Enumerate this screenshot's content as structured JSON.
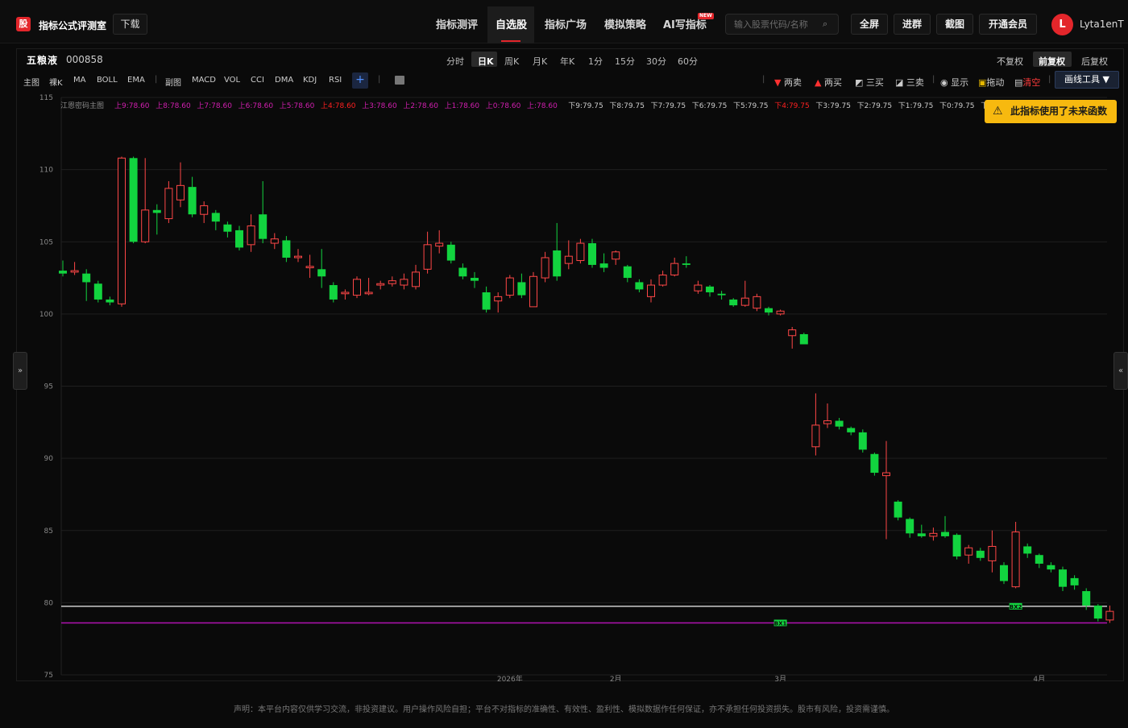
{
  "topbar": {
    "logo_char": "股",
    "brand": "指标公式评测室",
    "download": "下载",
    "nav": [
      "指标测评",
      "自选股",
      "指标广场",
      "模拟策略",
      "AI写指标"
    ],
    "new_badge": "NEW",
    "search_placeholder": "输入股票代码/名称",
    "buttons": [
      "全屏",
      "进群",
      "截图",
      "开通会员"
    ],
    "avatar_letter": "L",
    "username": "Lyta1enT"
  },
  "stock": {
    "name": "五粮液",
    "code": "000858"
  },
  "periods": [
    "分时",
    "日K",
    "周K",
    "月K",
    "年K",
    "1分",
    "15分",
    "30分",
    "60分"
  ],
  "active_period": "日K",
  "rights": [
    "不复权",
    "前复权",
    "后复权"
  ],
  "active_rights": "前复权",
  "indicators": {
    "main_label": "主图",
    "main": [
      "裸K",
      "MA",
      "BOLL",
      "EMA"
    ],
    "sub_label": "副图",
    "sub": [
      "MACD",
      "VOL",
      "CCI",
      "DMA",
      "KDJ",
      "RSI"
    ],
    "plus": "+"
  },
  "tools": [
    "两卖",
    "两买",
    "三买",
    "三卖",
    "显示",
    "拖动",
    "清空"
  ],
  "draw_tools": "画线工具 ▼",
  "warning": "此指标使用了未来函数",
  "legend": {
    "title": "江恩密码主图",
    "items": [
      {
        "text": "上9:78.60",
        "color": "#d21fb0"
      },
      {
        "text": "上8:78.60",
        "color": "#d21fb0"
      },
      {
        "text": "上7:78.60",
        "color": "#d21fb0"
      },
      {
        "text": "上6:78.60",
        "color": "#d21fb0"
      },
      {
        "text": "上5:78.60",
        "color": "#d21fb0"
      },
      {
        "text": "上4:78.60",
        "color": "#ff2020"
      },
      {
        "text": "上3:78.60",
        "color": "#d21fb0"
      },
      {
        "text": "上2:78.60",
        "color": "#d21fb0"
      },
      {
        "text": "上1:78.60",
        "color": "#d21fb0"
      },
      {
        "text": "上0:78.60",
        "color": "#d21fb0"
      },
      {
        "text": "上:78.60",
        "color": "#d21fb0"
      },
      {
        "text": "下9:79.75",
        "color": "#cccccc"
      },
      {
        "text": "下8:79.75",
        "color": "#cccccc"
      },
      {
        "text": "下7:79.75",
        "color": "#cccccc"
      },
      {
        "text": "下6:79.75",
        "color": "#cccccc"
      },
      {
        "text": "下5:79.75",
        "color": "#cccccc"
      },
      {
        "text": "下4:79.75",
        "color": "#ff2020"
      },
      {
        "text": "下3:79.75",
        "color": "#cccccc"
      },
      {
        "text": "下2:79.75",
        "color": "#cccccc"
      },
      {
        "text": "下1:79.75",
        "color": "#cccccc"
      },
      {
        "text": "下0:79.75",
        "color": "#cccccc"
      },
      {
        "text": "下",
        "color": "#cccccc"
      }
    ]
  },
  "chart_data": {
    "type": "candlestick",
    "y_ticks": [
      115,
      110,
      105,
      100,
      95,
      90,
      85,
      80,
      75
    ],
    "ylim": [
      75,
      115
    ],
    "x_labels": [
      "2026年",
      "2月",
      "3月",
      "4月"
    ],
    "x_label_index": [
      38,
      47,
      61,
      83
    ],
    "lines": [
      {
        "name": "上",
        "value": 78.6,
        "color": "#b012b0",
        "tag": "BX1",
        "tag_index": 61
      },
      {
        "name": "下",
        "value": 79.75,
        "color": "#cccccc",
        "tag": "BX2",
        "tag_index": 81
      }
    ],
    "up_color": "#ff4747",
    "down_color": "#12d43f",
    "candles": [
      [
        103.0,
        102.8,
        103.7,
        102.6
      ],
      [
        102.9,
        103.0,
        103.6,
        102.7
      ],
      [
        102.8,
        102.2,
        103.1,
        100.9
      ],
      [
        102.1,
        101.0,
        102.3,
        100.8
      ],
      [
        101.0,
        100.8,
        101.2,
        100.6
      ],
      [
        100.7,
        110.8,
        110.9,
        100.5
      ],
      [
        110.8,
        105.0,
        110.9,
        104.9
      ],
      [
        105.0,
        107.2,
        110.8,
        104.9
      ],
      [
        107.2,
        107.0,
        107.6,
        105.5
      ],
      [
        106.6,
        108.7,
        109.2,
        106.3
      ],
      [
        107.9,
        108.9,
        110.5,
        107.4
      ],
      [
        108.8,
        106.9,
        109.5,
        106.7
      ],
      [
        106.9,
        107.5,
        107.8,
        106.3
      ],
      [
        107.0,
        106.4,
        107.2,
        105.8
      ],
      [
        106.2,
        105.7,
        106.4,
        105.3
      ],
      [
        105.8,
        104.6,
        106.1,
        104.4
      ],
      [
        104.8,
        106.1,
        106.9,
        104.3
      ],
      [
        106.9,
        105.2,
        109.2,
        104.9
      ],
      [
        104.9,
        105.2,
        105.6,
        104.5
      ],
      [
        105.1,
        103.9,
        105.4,
        103.6
      ],
      [
        103.9,
        104.0,
        104.5,
        103.6
      ],
      [
        103.2,
        103.3,
        104.1,
        102.5
      ],
      [
        103.1,
        102.6,
        104.5,
        101.8
      ],
      [
        102.0,
        101.0,
        102.2,
        100.8
      ],
      [
        101.4,
        101.5,
        101.7,
        101.0
      ],
      [
        101.3,
        102.4,
        102.6,
        101.1
      ],
      [
        101.4,
        101.5,
        102.5,
        101.3
      ],
      [
        102.0,
        102.1,
        102.3,
        101.7
      ],
      [
        102.1,
        102.3,
        102.6,
        101.9
      ],
      [
        102.0,
        102.4,
        102.8,
        101.7
      ],
      [
        101.9,
        102.9,
        103.4,
        101.7
      ],
      [
        103.1,
        104.8,
        105.7,
        102.8
      ],
      [
        104.7,
        104.9,
        105.8,
        104.2
      ],
      [
        104.8,
        103.7,
        105.0,
        103.5
      ],
      [
        103.2,
        102.6,
        103.5,
        102.4
      ],
      [
        102.5,
        102.3,
        102.9,
        101.8
      ],
      [
        101.5,
        100.3,
        101.9,
        100.1
      ],
      [
        100.9,
        101.2,
        101.5,
        100.1
      ],
      [
        101.3,
        102.5,
        102.7,
        101.1
      ],
      [
        102.2,
        101.3,
        102.8,
        101.1
      ],
      [
        100.5,
        102.6,
        102.9,
        100.5
      ],
      [
        102.5,
        103.9,
        104.3,
        102.2
      ],
      [
        104.4,
        102.6,
        106.3,
        102.3
      ],
      [
        103.5,
        104.0,
        105.1,
        103.1
      ],
      [
        103.7,
        104.9,
        105.2,
        103.5
      ],
      [
        104.9,
        103.4,
        105.2,
        103.2
      ],
      [
        103.5,
        103.2,
        104.2,
        102.9
      ],
      [
        103.8,
        104.3,
        104.4,
        103.4
      ],
      [
        103.3,
        102.5,
        103.4,
        102.2
      ],
      [
        102.2,
        101.7,
        102.4,
        101.5
      ],
      [
        101.2,
        102.0,
        102.4,
        100.8
      ],
      [
        102.0,
        102.7,
        103.0,
        101.9
      ],
      [
        102.7,
        103.5,
        103.9,
        102.6
      ],
      [
        103.5,
        103.4,
        104.0,
        103.2
      ],
      [
        101.6,
        102.0,
        102.3,
        101.4
      ],
      [
        101.9,
        101.5,
        102.0,
        101.2
      ],
      [
        101.4,
        101.3,
        101.6,
        101.0
      ],
      [
        101.0,
        100.6,
        101.1,
        100.5
      ],
      [
        100.6,
        101.1,
        102.3,
        100.5
      ],
      [
        100.4,
        101.2,
        101.4,
        100.2
      ],
      [
        100.4,
        100.1,
        100.5,
        99.9
      ],
      [
        100.0,
        100.2,
        100.3,
        99.9
      ],
      [
        98.5,
        98.9,
        99.1,
        97.6
      ],
      [
        98.6,
        97.9,
        98.7,
        97.9
      ],
      [
        90.8,
        92.3,
        94.5,
        90.2
      ],
      [
        92.4,
        92.6,
        93.8,
        92.1
      ],
      [
        92.6,
        92.2,
        92.8,
        92.0
      ],
      [
        92.1,
        91.8,
        92.2,
        91.6
      ],
      [
        91.8,
        90.6,
        92.0,
        90.4
      ],
      [
        90.3,
        89.0,
        90.4,
        88.8
      ],
      [
        88.8,
        89.0,
        91.2,
        84.4
      ],
      [
        87.0,
        85.9,
        87.1,
        85.7
      ],
      [
        85.8,
        84.8,
        85.9,
        84.5
      ],
      [
        84.8,
        84.6,
        85.4,
        84.5
      ],
      [
        84.6,
        84.8,
        85.2,
        84.3
      ],
      [
        84.9,
        84.6,
        86.0,
        84.5
      ],
      [
        84.7,
        83.2,
        84.8,
        83.0
      ],
      [
        83.3,
        83.8,
        84.0,
        82.7
      ],
      [
        83.6,
        83.1,
        83.8,
        82.9
      ],
      [
        82.9,
        83.9,
        85.0,
        82.1
      ],
      [
        82.6,
        81.5,
        82.8,
        81.3
      ],
      [
        81.1,
        84.9,
        85.6,
        81.0
      ],
      [
        83.9,
        83.4,
        84.1,
        83.1
      ],
      [
        83.3,
        82.7,
        83.4,
        82.4
      ],
      [
        82.6,
        82.3,
        82.8,
        82.1
      ],
      [
        82.3,
        81.1,
        82.5,
        80.8
      ],
      [
        81.7,
        81.2,
        81.9,
        80.9
      ],
      [
        80.8,
        79.8,
        81.0,
        79.5
      ],
      [
        79.8,
        78.9,
        79.9,
        78.7
      ],
      [
        78.8,
        79.4,
        79.8,
        78.6
      ]
    ]
  },
  "footer": "声明：本平台内容仅供学习交流，非投资建议。用户操作风险自担；平台不对指标的准确性、有效性、盈利性、模拟数据作任何保证，亦不承担任何投资损失。股市有风险，投资需谨慎。",
  "side_left": "»",
  "side_right": "«"
}
